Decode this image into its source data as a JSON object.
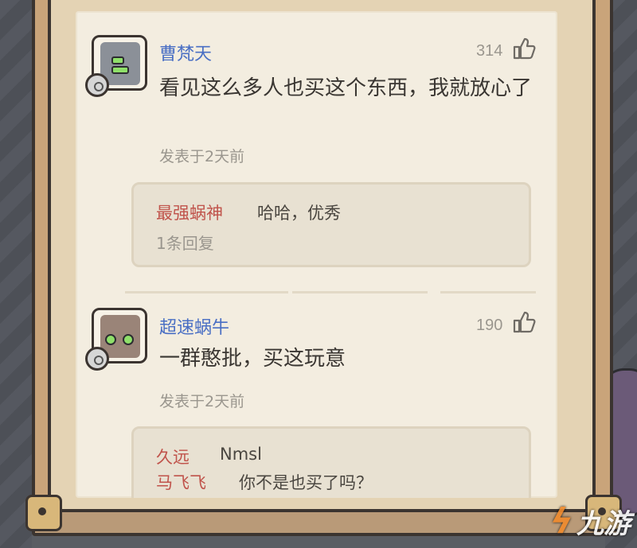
{
  "comments": [
    {
      "username": "曹梵天",
      "likes": "314",
      "content": "看见这么多人也买这个东西，我就放心了",
      "posted": "发表于2天前",
      "replies": [
        {
          "user": "最强蜗神",
          "text": "哈哈，优秀"
        }
      ],
      "reply_count": "1条回复"
    },
    {
      "username": "超速蜗牛",
      "likes": "190",
      "content": "一群憨批，买这玩意",
      "posted": "发表于2天前",
      "replies": [
        {
          "user": "久远",
          "text": "Nmsl"
        },
        {
          "user": "马飞飞",
          "text": "你不是也买了吗？"
        }
      ]
    }
  ],
  "watermark": "九游",
  "colors": {
    "username": "#4a6fc4",
    "reply_user": "#c0534b",
    "paper": "#f3ede0",
    "frame": "#c9a47a"
  },
  "icons": [
    "thumbs-up-icon",
    "snail-badge-icon",
    "avatar-image"
  ]
}
